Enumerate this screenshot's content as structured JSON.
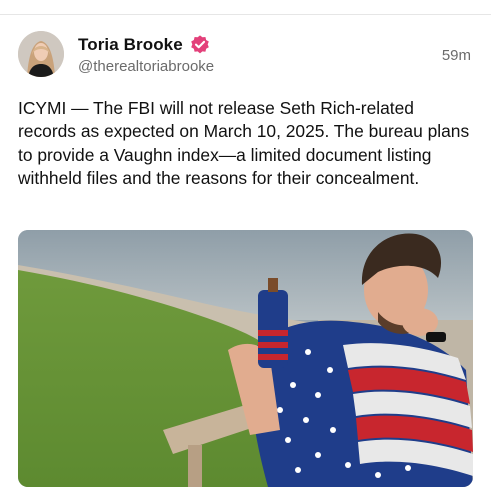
{
  "post": {
    "author": {
      "display_name": "Toria Brooke",
      "handle": "@therealtoriabrooke",
      "verified": true,
      "avatar_icon": "avatar-photo"
    },
    "timestamp": "59m",
    "text": "ICYMI — The FBI will not release Seth Rich-related records as expected on March 10, 2025. The bureau plans to provide a Vaughn index—a limited document listing withheld files and the reasons for their concealment.",
    "media": {
      "type": "photo",
      "icon": "post-photo"
    }
  },
  "colors": {
    "verified_badge": "#e3407a",
    "text": "#111111",
    "muted": "#6b6b6b",
    "divider": "#e6e6e6"
  }
}
